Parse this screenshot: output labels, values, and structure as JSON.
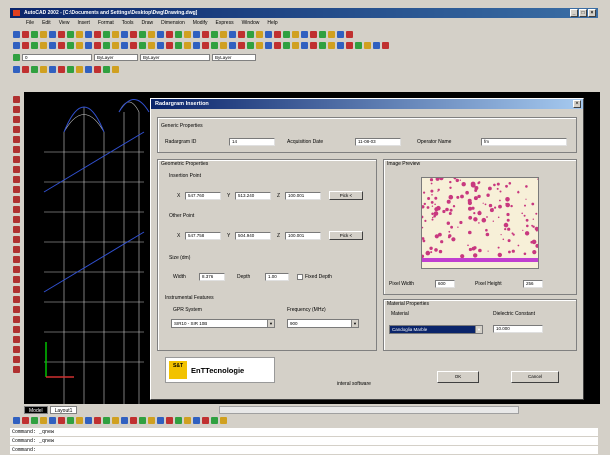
{
  "window": {
    "title": "AutoCAD 2002 - [C:\\Documents and Settings\\Desktop\\Dwg\\Drawing.dwg]",
    "buttons": [
      "_",
      "□",
      "×"
    ]
  },
  "menu": [
    "File",
    "Edit",
    "View",
    "Insert",
    "Format",
    "Tools",
    "Draw",
    "Dimension",
    "Modify",
    "Express",
    "Window",
    "Help"
  ],
  "layer_combo": "0",
  "linetype_combo": "ByLayer",
  "lineweight_combo": "ByLayer",
  "color_combo": "ByLayer",
  "colors": {
    "icon_a": "#3060c0",
    "icon_b": "#c03030",
    "icon_c": "#30a040",
    "icon_d": "#d0a020"
  },
  "layout_tabs": [
    "Model",
    "Layout1"
  ],
  "command_lines": [
    "Command: _qnew",
    "Command: _qnew",
    "Command:"
  ],
  "dialog": {
    "title": "Radargram Insertion",
    "generic": {
      "heading": "Generic Properties",
      "id_label": "Radargram ID",
      "id_value": "14",
      "date_label": "Acquisition Date",
      "date_value": "11-08-03",
      "operator_label": "Operator Name",
      "operator_value": "fm"
    },
    "geometric": {
      "heading": "Geometric Properties",
      "insertion_heading": "Insertion Point",
      "insertion": {
        "x": "547.760",
        "y": "513.240",
        "z": "100.001"
      },
      "other_heading": "Other Point",
      "other": {
        "x": "547.758",
        "y": "504.940",
        "z": "100.001"
      },
      "pick_label": "Pick <",
      "size_heading": "Size (dm)",
      "width_label": "Width",
      "width_value": "8.376",
      "depth_label": "Depth",
      "depth_value": "1.00",
      "fixed_label": "Fixed Depth"
    },
    "instrumental": {
      "heading": "Instrumental Features",
      "gpr_label": "GPR System",
      "gpr_value": "SIR10 - SIR 10B",
      "freq_label": "Frequency (MHz)",
      "freq_value": "900"
    },
    "preview": {
      "heading": "Image Preview",
      "pw_label": "Pixel Width",
      "pw_value": "600",
      "ph_label": "Pixel Height",
      "ph_value": "256"
    },
    "material": {
      "heading": "Material Properties",
      "material_label": "Material",
      "material_value": "Candoglia Marble",
      "dielectric_label": "Dielectric Constant",
      "dielectric_value": "10.000"
    },
    "logo": {
      "mark": "S&T",
      "name": "EnTTecnologie"
    },
    "company": "interal software",
    "ok_label": "OK",
    "cancel_label": "Cancel"
  }
}
